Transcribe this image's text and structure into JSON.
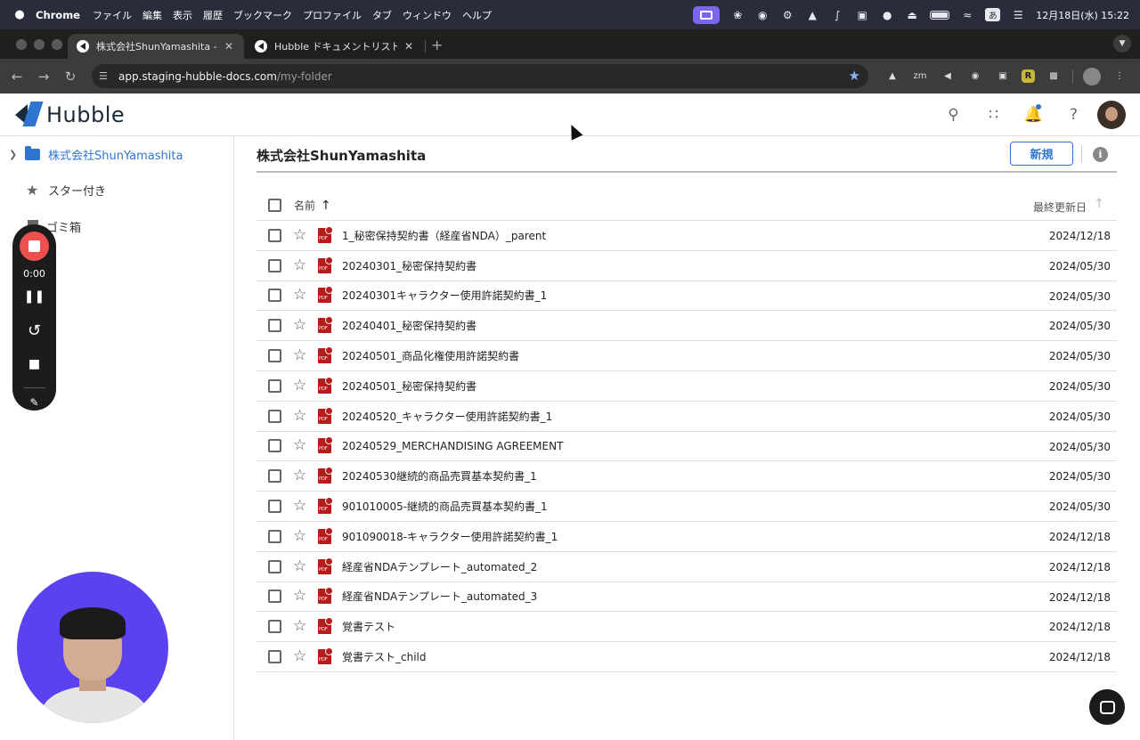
{
  "menubar": {
    "app_name": "Chrome",
    "menus": [
      "ファイル",
      "編集",
      "表示",
      "履歴",
      "ブックマーク",
      "プロファイル",
      "タブ",
      "ウィンドウ",
      "ヘルプ"
    ],
    "ime": "あ",
    "clock": "12月18日(水)  15:22"
  },
  "tabs": [
    {
      "title": "株式会社ShunYamashita - Hubb",
      "active": true
    },
    {
      "title": "Hubble ドキュメントリスト",
      "active": false
    }
  ],
  "toolbar": {
    "url_host": "app.staging-hubble-docs.com",
    "url_path": "/my-folder",
    "ext_r_label": "R"
  },
  "app": {
    "logo_text": "Hubble"
  },
  "sidebar": {
    "items": [
      {
        "label": "株式会社ShunYamashita"
      },
      {
        "label": "スター付き"
      },
      {
        "label": "ゴミ箱"
      }
    ]
  },
  "recorder": {
    "time": "0:00"
  },
  "main": {
    "folder_title": "株式会社ShunYamashita",
    "new_button": "新規",
    "columns": {
      "name": "名前",
      "date": "最終更新日"
    },
    "rows": [
      {
        "name": "1_秘密保持契約書（経産省NDA）_parent",
        "date": "2024/12/18"
      },
      {
        "name": "20240301_秘密保持契約書",
        "date": "2024/05/30"
      },
      {
        "name": "20240301キャラクター使用許諾契約書_1",
        "date": "2024/05/30"
      },
      {
        "name": "20240401_秘密保持契約書",
        "date": "2024/05/30"
      },
      {
        "name": "20240501_商品化権使用許諾契約書",
        "date": "2024/05/30"
      },
      {
        "name": "20240501_秘密保持契約書",
        "date": "2024/05/30"
      },
      {
        "name": "20240520_キャラクター使用許諾契約書_1",
        "date": "2024/05/30"
      },
      {
        "name": "20240529_MERCHANDISING AGREEMENT",
        "date": "2024/05/30"
      },
      {
        "name": "20240530継続的商品売買基本契約書_1",
        "date": "2024/05/30"
      },
      {
        "name": "901010005-継続的商品売買基本契約書_1",
        "date": "2024/05/30"
      },
      {
        "name": "901090018-キャラクター使用許諾契約書_1",
        "date": "2024/12/18"
      },
      {
        "name": "経産省NDAテンプレート_automated_2",
        "date": "2024/12/18"
      },
      {
        "name": "経産省NDAテンプレート_automated_3",
        "date": "2024/12/18"
      },
      {
        "name": "覚書テスト",
        "date": "2024/12/18"
      },
      {
        "name": "覚書テスト_child",
        "date": "2024/12/18"
      }
    ]
  },
  "colors": {
    "accent": "#2e74d0",
    "record_red": "#ee4f4f",
    "pdf_red": "#b71c1c",
    "webcam_bg": "#5a42f0"
  }
}
